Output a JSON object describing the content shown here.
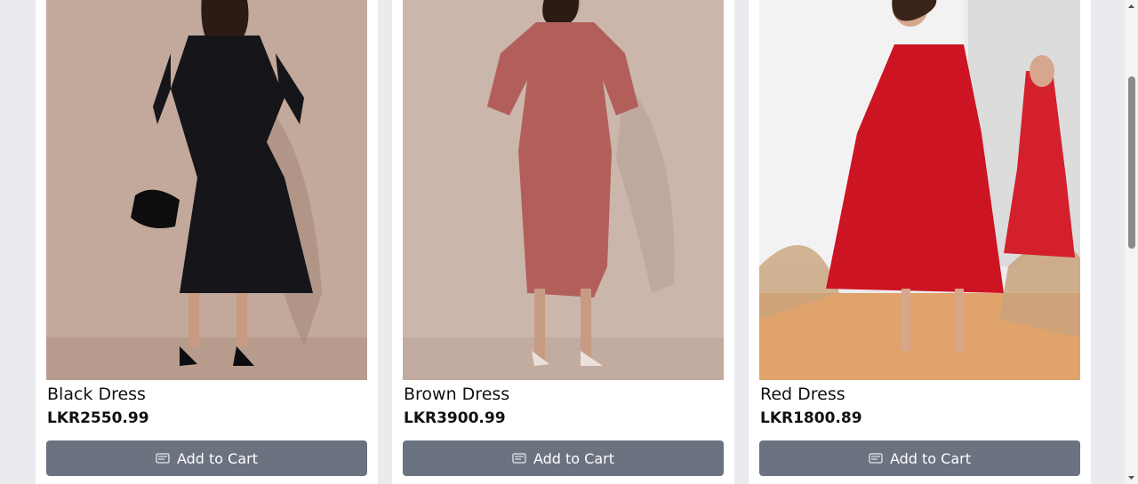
{
  "products": [
    {
      "name": "Black Dress",
      "price": "LKR2550.99",
      "button_label": "Add to Cart",
      "image": {
        "alt": "Black Dress",
        "background": "#c3a99b",
        "garment_color": "#15151a"
      }
    },
    {
      "name": "Brown Dress",
      "price": "LKR3900.99",
      "button_label": "Add to Cart",
      "image": {
        "alt": "Brown Dress",
        "background": "#cbb6ab",
        "garment_color": "#b25f5c"
      }
    },
    {
      "name": "Red Dress",
      "price": "LKR1800.89",
      "button_label": "Add to Cart",
      "image": {
        "alt": "Red Dress",
        "background": "#ececec",
        "garment_color": "#cc1422"
      }
    }
  ],
  "icons": {
    "cart": "cart-icon"
  },
  "colors": {
    "page_background": "#e9ebef",
    "button": "#6b7280",
    "button_text": "#ffffff"
  }
}
